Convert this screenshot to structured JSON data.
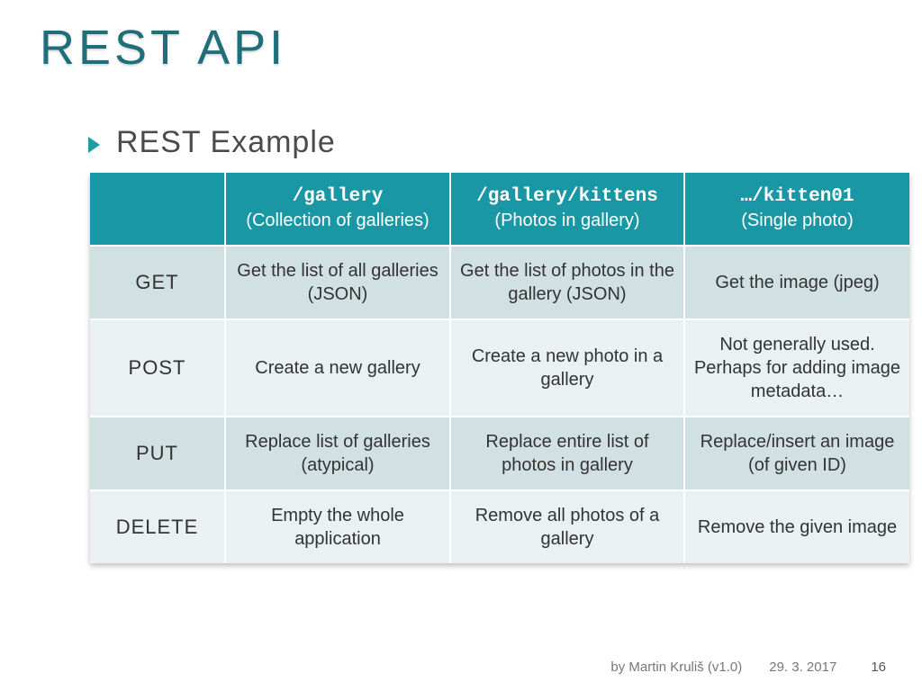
{
  "title": "REST API",
  "subhead": "REST Example",
  "table": {
    "headers": [
      {
        "mono": "/gallery",
        "sub": "(Collection of galleries)"
      },
      {
        "mono": "/gallery/kittens",
        "sub": "(Photos in gallery)"
      },
      {
        "mono": "…/kitten01",
        "sub": "(Single photo)"
      }
    ],
    "rows": [
      {
        "method": "GET",
        "cells": [
          "Get the list of all galleries (JSON)",
          "Get the list of photos in the gallery (JSON)",
          "Get the image (jpeg)"
        ]
      },
      {
        "method": "POST",
        "cells": [
          "Create a new gallery",
          "Create a new photo in a gallery",
          "Not generally used. Perhaps for adding image metadata…"
        ]
      },
      {
        "method": "PUT",
        "cells": [
          "Replace list of galleries (atypical)",
          "Replace entire list of photos in gallery",
          "Replace/insert an image (of given ID)"
        ]
      },
      {
        "method": "DELETE",
        "cells": [
          "Empty the whole application",
          "Remove all photos of a gallery",
          "Remove the given image"
        ]
      }
    ]
  },
  "footer": {
    "author": "by Martin Kruliš (v1.0)",
    "date": "29. 3. 2017",
    "page": "16"
  }
}
